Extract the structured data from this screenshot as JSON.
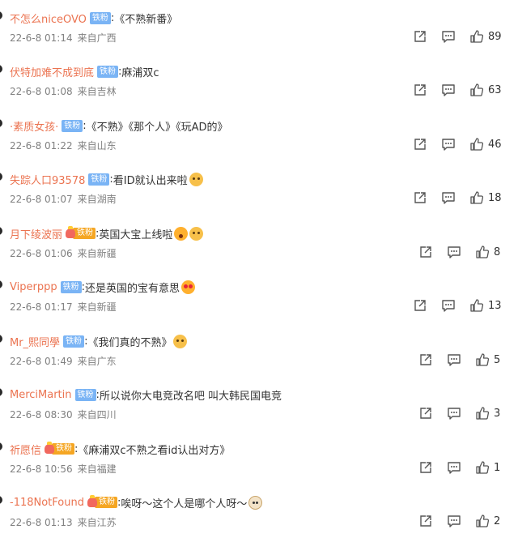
{
  "comments": [
    {
      "user": "不怎么niceOVO",
      "badge_type": "fan",
      "badge": "铁粉",
      "text": "《不熟新番》",
      "emojis": [],
      "date": "22-6-8 01:14",
      "location": "来自广西",
      "likes": "89"
    },
    {
      "user": "伏特加难不成到底",
      "badge_type": "fan",
      "badge": "铁粉",
      "text": "麻浦双c",
      "emojis": [],
      "date": "22-6-8 01:08",
      "location": "来自吉林",
      "likes": "63"
    },
    {
      "user": "·素质女孩·",
      "badge_type": "fan",
      "badge": "铁粉",
      "text": "《不熟》《那个人》《玩AD的》",
      "emojis": [],
      "date": "22-6-8 01:22",
      "location": "来自山东",
      "likes": "46"
    },
    {
      "user": "失踪人口93578",
      "badge_type": "fan",
      "badge": "铁粉",
      "text": "看ID就认出来啦",
      "emojis": [
        "dog-emoji"
      ],
      "date": "22-6-8 01:07",
      "location": "来自湖南",
      "likes": "18"
    },
    {
      "user": "月下绫波丽",
      "badge_type": "crown",
      "badge": "铁粉",
      "text": "英国大宝上线啦",
      "emojis": [
        "surprised-emoji",
        "dog-emoji"
      ],
      "date": "22-6-8 01:06",
      "location": "来自新疆",
      "likes": "8"
    },
    {
      "user": "Viperppp",
      "badge_type": "fan",
      "badge": "铁粉",
      "text": "还是英国的宝有意思",
      "emojis": [
        "heart-eyes-emoji"
      ],
      "date": "22-6-8 01:17",
      "location": "来自新疆",
      "likes": "13"
    },
    {
      "user": "Mr_熙同學",
      "badge_type": "fan",
      "badge": "铁粉",
      "text": "《我们真的不熟》",
      "emojis": [
        "dog-emoji"
      ],
      "date": "22-6-8 01:49",
      "location": "来自广东",
      "likes": "5"
    },
    {
      "user": "MerciMartin",
      "badge_type": "fan",
      "badge": "铁粉",
      "text": "所以说你大电竞改名吧 叫大韩民国电竞",
      "emojis": [],
      "date": "22-6-8 08:30",
      "location": "来自四川",
      "likes": "3"
    },
    {
      "user": "祈愿信",
      "badge_type": "crown",
      "badge": "铁粉",
      "text": "《麻浦双c不熟之看id认出对方》",
      "emojis": [],
      "date": "22-6-8 10:56",
      "location": "来自福建",
      "likes": "1"
    },
    {
      "user": "-118NotFound",
      "badge_type": "crown",
      "badge": "铁粉",
      "text": "唉呀～这个人是哪个人呀～",
      "emojis": [
        "cat-emoji"
      ],
      "date": "22-6-8 01:13",
      "location": "来自江苏",
      "likes": "2"
    }
  ],
  "icons": {
    "share": "share-icon",
    "comment": "comment-icon",
    "like": "thumbs-up-icon"
  },
  "colors": {
    "username": "#eb7350",
    "meta": "#808080",
    "text": "#333333",
    "fan_badge": "#7ab4f5",
    "crown_badge": "#f5a623"
  }
}
